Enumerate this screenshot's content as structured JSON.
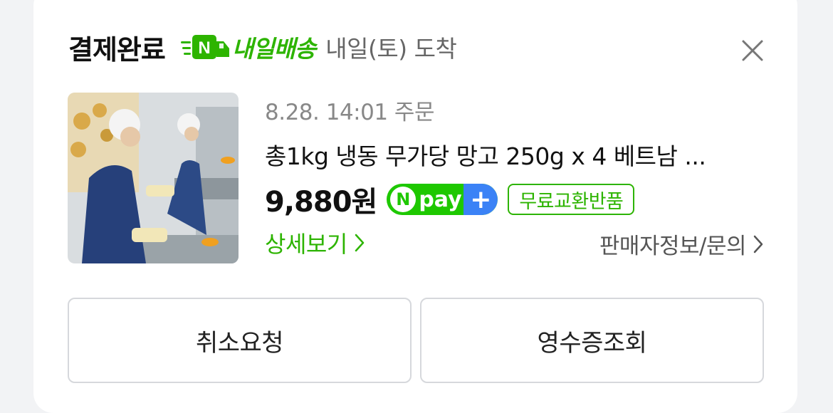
{
  "header": {
    "title": "결제완료",
    "delivery_badge": "내일배송",
    "arrival_text": "내일(토) 도착"
  },
  "order": {
    "date_text": "8.28. 14:01 주문",
    "product_name": "총1kg 냉동 무가당 망고 250g x 4 베트남 ...",
    "price": "9,880원",
    "npay_label": "pay",
    "exchange_badge": "무료교환반품"
  },
  "links": {
    "detail": "상세보기",
    "seller": "판매자정보/문의"
  },
  "buttons": {
    "cancel": "취소요청",
    "receipt": "영수증조회"
  },
  "colors": {
    "brand_green": "#2db400",
    "npay_green": "#1ec800",
    "npay_blue": "#3b82f6"
  },
  "icons": [
    "truck-n-icon",
    "close-icon",
    "chevron-right-icon",
    "npay-plus-icon"
  ]
}
